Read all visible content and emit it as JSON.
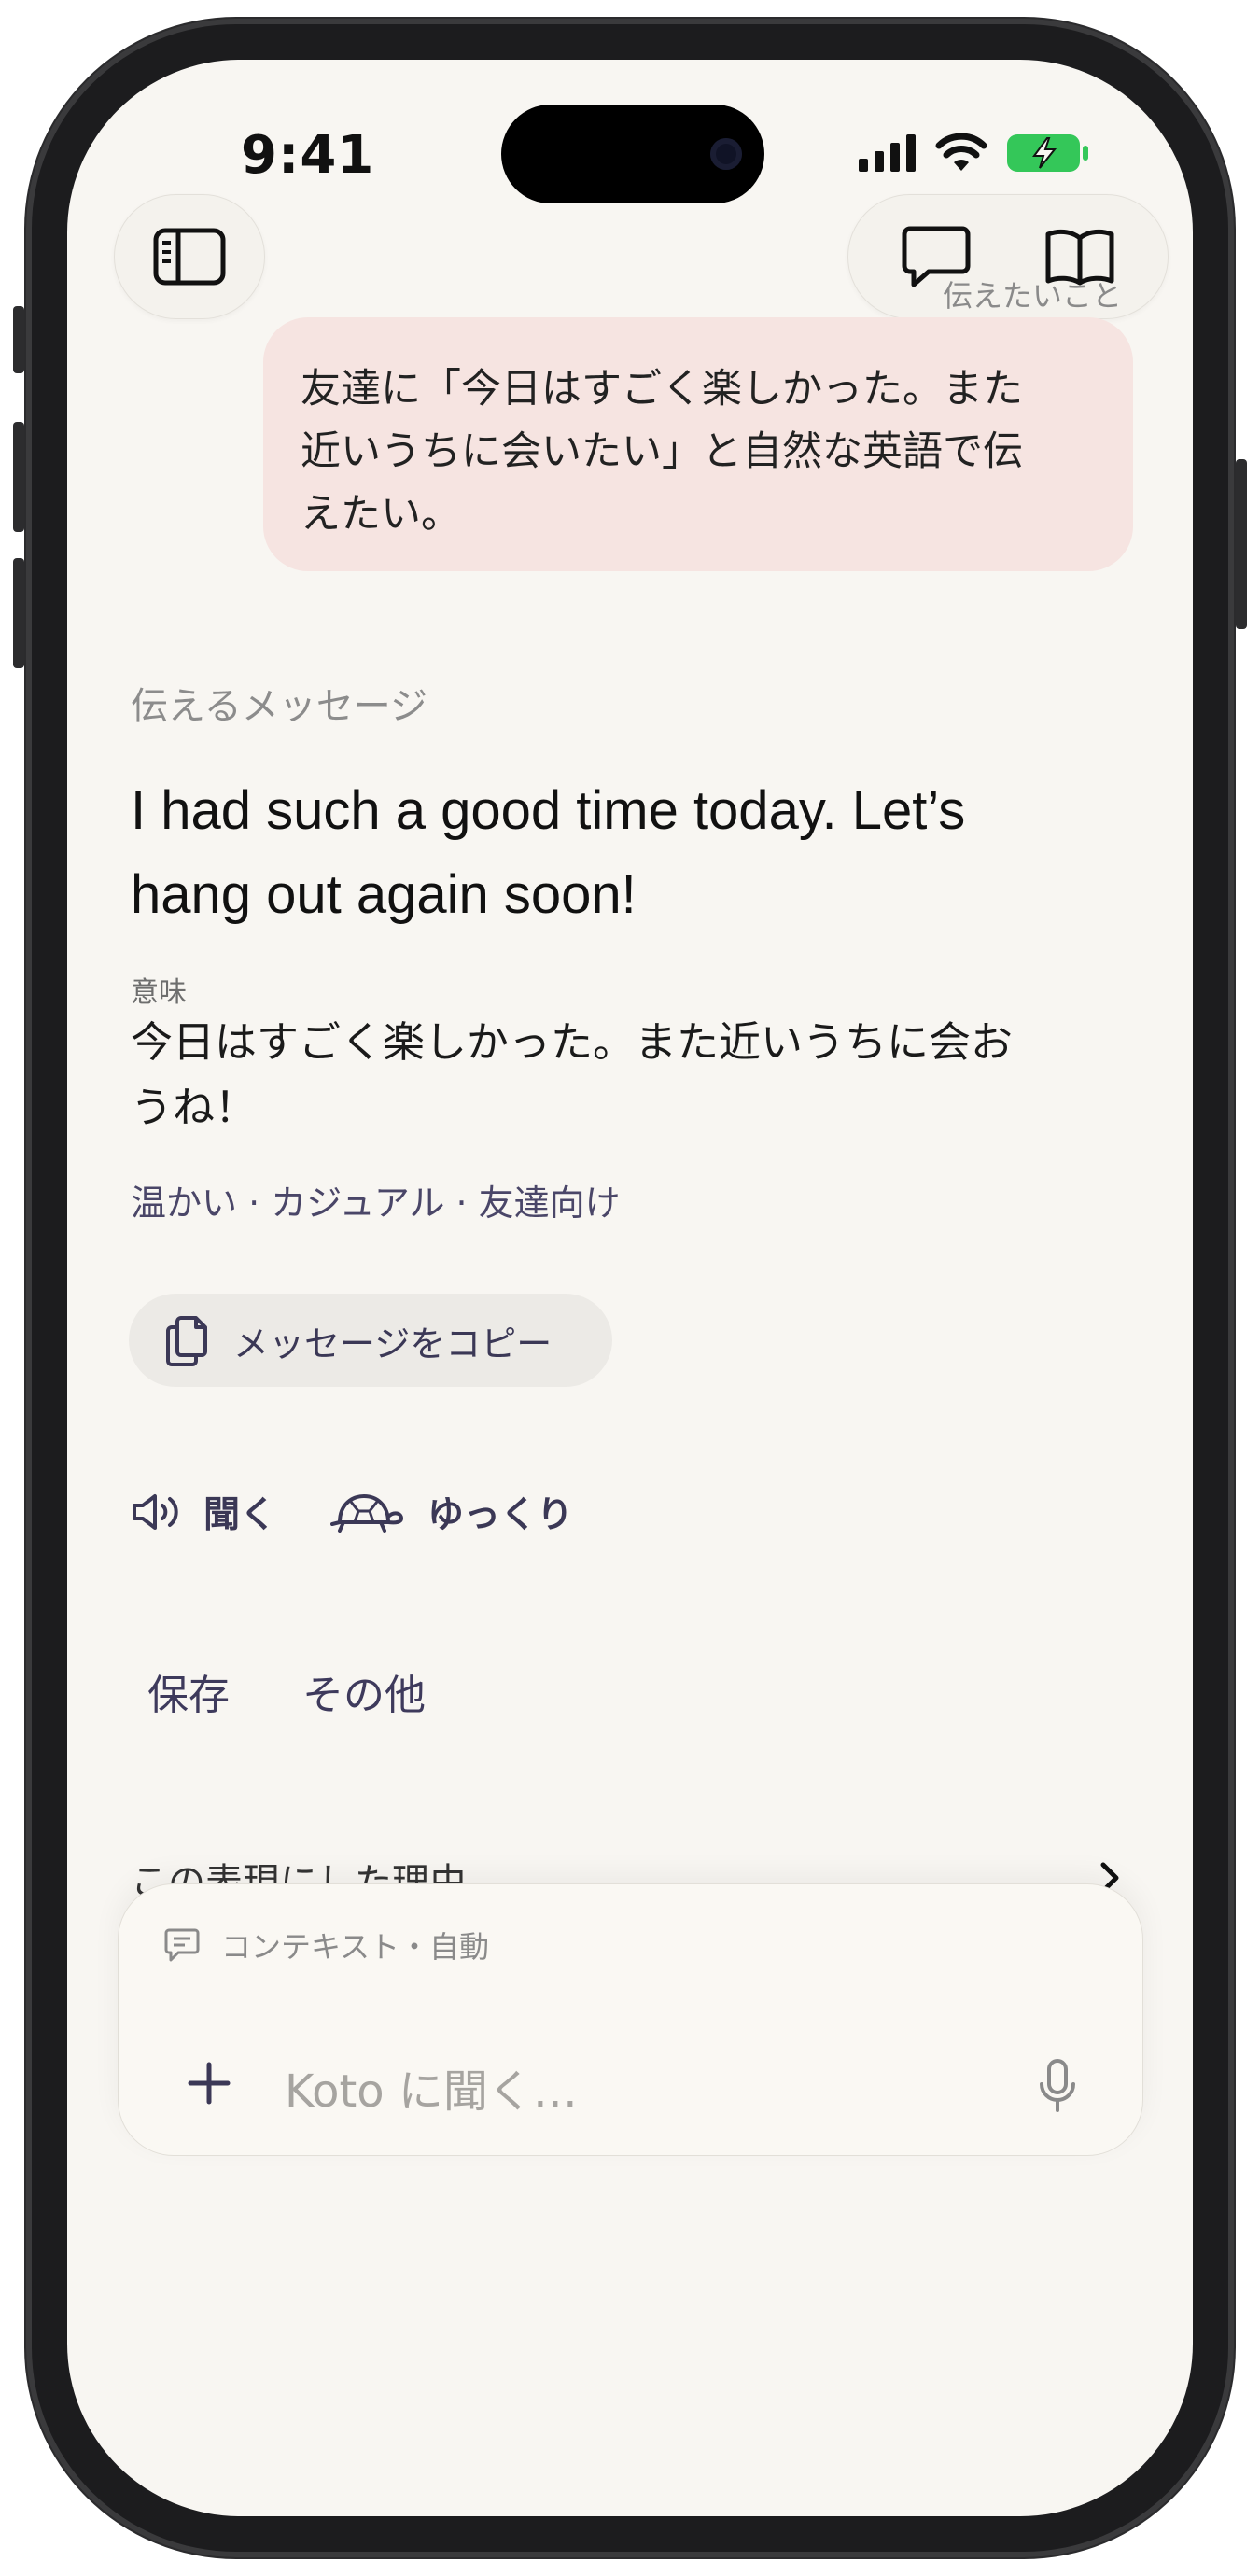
{
  "status_bar": {
    "time": "9:41"
  },
  "header": {
    "sidebar_icon": "sidebar-icon",
    "chat_icon": "chat-bubble-icon",
    "book_icon": "book-icon"
  },
  "user_message": {
    "label": "伝えたいこと",
    "line1": "友達に「今日はすごく楽しかった。また",
    "line2": "近いうちに会いたい」と自然な英語で伝",
    "line3": "えたい。"
  },
  "result": {
    "section_label": "伝えるメッセージ",
    "headline_line1": "I had such a good time today. Let’s",
    "headline_line2": "hang out again soon!",
    "meaning_label": "意味",
    "meaning_line1": "今日はすごく楽しかった。また近いうちに会お",
    "meaning_line2": "うね！",
    "tone": "温かい · カジュアル · 友達向け",
    "copy_label": "メッセージをコピー",
    "listen_label": "聞く",
    "slow_label": "ゆっくり",
    "save_label": "保存",
    "more_label": "その他",
    "reason_label": "この表現にした理由"
  },
  "composer": {
    "context_label": "コンテキスト・自動",
    "placeholder": "Koto に聞く…"
  }
}
